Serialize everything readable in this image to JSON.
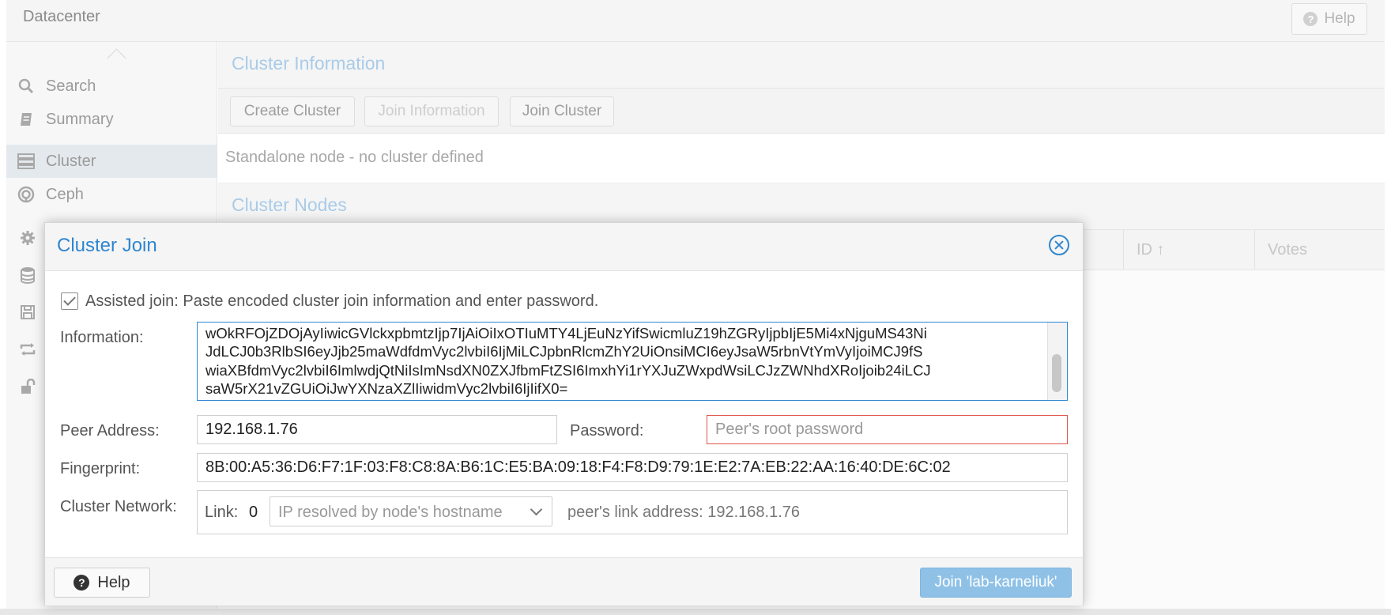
{
  "app": {
    "title": "Datacenter",
    "help_label": "Help"
  },
  "sidebar": {
    "items": [
      {
        "label": "Search",
        "icon": "search-icon"
      },
      {
        "label": "Summary",
        "icon": "book-icon"
      },
      {
        "label": "Cluster",
        "icon": "server-icon",
        "active": true
      },
      {
        "label": "Ceph",
        "icon": "ceph-icon"
      }
    ],
    "icon_only_items": [
      "gear-icon",
      "database-icon",
      "save-icon",
      "replication-icon",
      "unlock-icon"
    ]
  },
  "main": {
    "cluster_info_title": "Cluster Information",
    "toolbar": {
      "create": "Create Cluster",
      "join_info": "Join Information",
      "join": "Join Cluster"
    },
    "status": "Standalone node - no cluster defined",
    "cluster_nodes_title": "Cluster Nodes",
    "columns": [
      {
        "label": "ID ↑"
      },
      {
        "label": "Votes"
      }
    ]
  },
  "dialog": {
    "title": "Cluster Join",
    "assisted_label": "Assisted join: Paste encoded cluster join information and enter password.",
    "assisted_checked": true,
    "information_label": "Information:",
    "information_lines": [
      "wOkRFOjZDOjAyIiwicGVlckxpbmtzIjp7IjAiOiIxOTIuMTY4LjEuNzYifSwicmluZ19hZGRyIjpbIjE5Mi4xNjguMS43Ni",
      "JdLCJ0b3RlbSI6eyJjb25maWdfdmVyc2lvbiI6IjMiLCJpbnRlcmZhY2UiOnsiMCI6eyJsaW5rbnVtYmVyIjoiMCJ9fS",
      "wiaXBfdmVyc2lvbiI6ImlwdjQtNiIsImNsdXN0ZXJfbmFtZSI6ImxhYi1rYXJuZWxpdWsiLCJzZWNhdXRoIjoib24iLCJ",
      "saW5rX21vZGUiOiJwYXNzaXZlIiwidmVyc2lvbiI6IjIifX0="
    ],
    "peer_address_label": "Peer Address:",
    "peer_address_value": "192.168.1.76",
    "password_label": "Password:",
    "password_placeholder": "Peer's root password",
    "fingerprint_label": "Fingerprint:",
    "fingerprint_value": "8B:00:A5:36:D6:F7:1F:03:F8:C8:8A:B6:1C:E5:BA:09:18:F4:F8:D9:79:1E:E2:7A:EB:22:AA:16:40:DE:6C:02",
    "cluster_network_label": "Cluster Network:",
    "link_label": "Link:",
    "link_number": "0",
    "link_select_value": "IP resolved by node's hostname",
    "peer_link_text": "peer's link address: 192.168.1.76",
    "help_button": "Help",
    "join_button": "Join 'lab-karneliuk'"
  },
  "colors": {
    "accent": "#2f86cf",
    "join_button_bg": "#8fc1e7",
    "invalid_border": "#e0554a"
  }
}
